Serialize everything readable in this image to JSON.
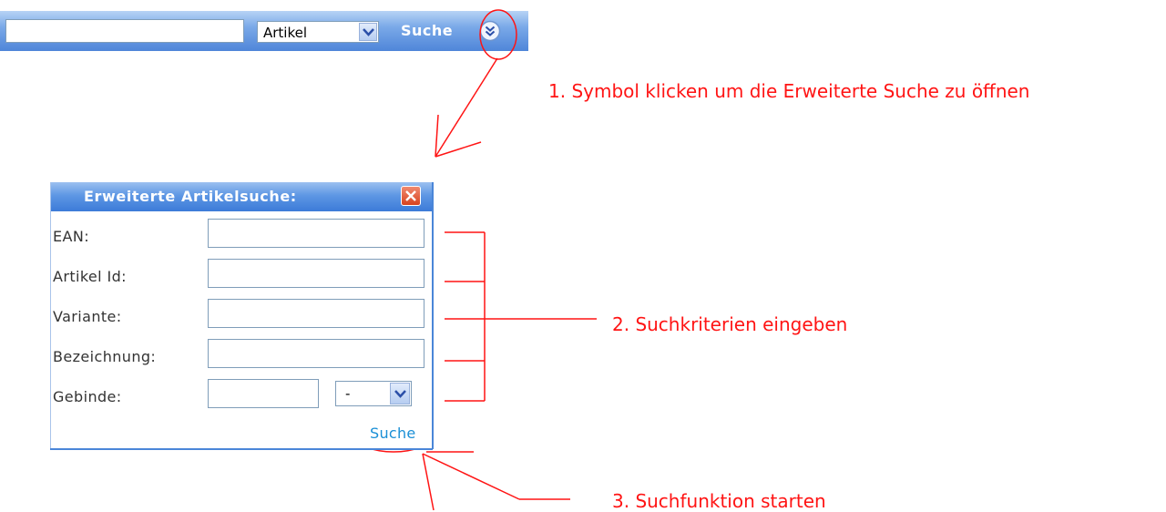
{
  "topbar": {
    "search_value": "",
    "category_selected": "Artikel",
    "search_button_label": "Suche",
    "expand_icon": "double-chevron-down-icon"
  },
  "annotations": {
    "step1": "1. Symbol klicken um die Erweiterte Suche zu öffnen",
    "step2": "2. Suchkriterien eingeben",
    "step3": "3. Suchfunktion starten",
    "color": "#ff1414"
  },
  "dialog": {
    "title": "Erweiterte Artikelsuche:",
    "close_icon": "close-icon",
    "fields": {
      "ean": {
        "label": "EAN:",
        "value": ""
      },
      "artikel_id": {
        "label": "Artikel Id:",
        "value": ""
      },
      "variante": {
        "label": "Variante:",
        "value": ""
      },
      "bezeichnung": {
        "label": "Bezeichnung:",
        "value": ""
      },
      "gebinde": {
        "label": "Gebinde:",
        "value": "",
        "unit_selected": "-"
      }
    },
    "search_link_label": "Suche"
  },
  "colors": {
    "header_blue": "#3c7bd8",
    "link_blue": "#1a8fd6",
    "close_red": "#d8431f"
  }
}
